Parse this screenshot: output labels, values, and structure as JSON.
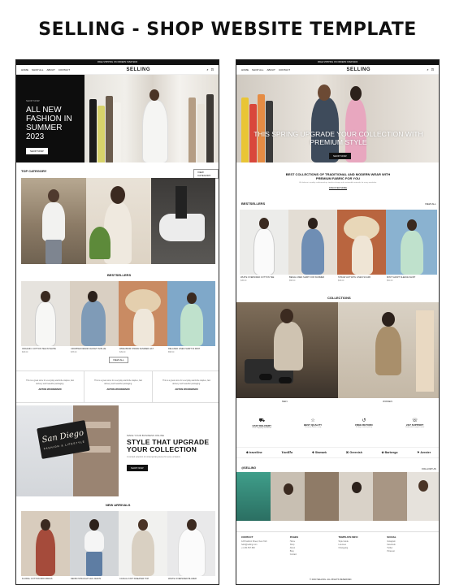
{
  "headline": "SELLING - SHOP WEBSITE TEMPLATE",
  "left": {
    "topbar": "FREE SHIPPING ON ORDERS OVER $100",
    "nav_links": [
      "HOME",
      "SHOP ALL",
      "ABOUT",
      "CONTACT"
    ],
    "logo": "SELLING",
    "hero": {
      "kicker": "SHOP NOW",
      "title_lines": [
        "ALL NEW",
        "FASHION IN",
        "SUMMER",
        "2023"
      ],
      "button": "SHOP NOW"
    },
    "top_category": {
      "label": "TOP CATEGORY",
      "button": "VIEW CATEGORY"
    },
    "bestsellers": {
      "label": "BESTSELLERS",
      "items": [
        {
          "name": "ORGANIC COTTON TEE IN WHITE",
          "price": "$45.00"
        },
        {
          "name": "CROPPED DENIM JACKET IN BLUE",
          "price": "$78.00"
        },
        {
          "name": "WIDE BRIM STRAW SUMMER HAT",
          "price": "$39.00"
        },
        {
          "name": "RELAXED LINEN SHIRT IN MINT",
          "price": "$58.00"
        }
      ],
      "button": "VIEW ALL"
    },
    "testimonials": [
      {
        "text": "This is a great store for everyday wardrobe staples, fast delivery and beautiful packaging.",
        "name": "ANTON WOODWARD"
      },
      {
        "text": "This is a great store for everyday wardrobe staples, fast delivery and beautiful packaging.",
        "name": "ANTON WOODWARD"
      },
      {
        "text": "This is a great store for everyday wardrobe staples, fast delivery and beautiful packaging.",
        "name": "ANTON WOODWARD"
      }
    ],
    "style": {
      "kicker": "MAKE YOUR BUSINESS ONLINE",
      "title_lines": [
        "STYLE THAT UPGRADE",
        "YOUR COLLECTION"
      ],
      "desc": "A curated selection of contemporary pieces for every occasion.",
      "button": "SHOP NOW",
      "sign_title": "San Diego",
      "sign_sub": "FASHION & LIFESTYLE"
    },
    "new_arrivals": {
      "label": "NEW ARRIVALS",
      "items": [
        {
          "name": "FLORAL COTTON MIDI DRESS",
          "price": "$64.00"
        },
        {
          "name": "DENIM STRAIGHT LEG JEANS",
          "price": "$72.00"
        },
        {
          "name": "CASUAL KNIT SWEATER TOP",
          "price": "$49.00"
        },
        {
          "name": "WHITE OVERSIZED BLAZER",
          "price": "$95.00"
        }
      ]
    }
  },
  "right": {
    "topbar": "FREE SHIPPING ON ORDERS OVER $100",
    "nav_links": [
      "HOME",
      "SHOP ALL",
      "ABOUT",
      "CONTACT"
    ],
    "logo": "SELLING",
    "hero": {
      "title_lines": [
        "THIS SPRING UPGRADE YOUR COLLECTION WITH",
        "PREMIUM STYLE"
      ],
      "button": "SHOP NOW"
    },
    "intro": {
      "title_lines": [
        "BEST COLLECTIONS OF TRADITIONAL AND MODERN WEAR WITH",
        "PREMIUM FABRIC FOR YOU"
      ],
      "desc": "We believe in quality craftsmanship, timeless design and sustainable materials for every wardrobe.",
      "link": "DISCOVER MORE"
    },
    "bestsellers": {
      "label": "BESTSELLERS",
      "link": "VIEW ALL",
      "items": [
        {
          "name": "WHITE OVERSIZED COTTON TEE",
          "price": "$45.00"
        },
        {
          "name": "BEIGE LINEN SHIRT FOR SUMMER",
          "price": "$58.00"
        },
        {
          "name": "STRAW HAT WITH LINEN SCARF",
          "price": "$39.00"
        },
        {
          "name": "MINT SHORT SLEEVE SHIRT",
          "price": "$52.00"
        }
      ]
    },
    "collections": {
      "label": "COLLECTIONS",
      "men": "MEN",
      "women": "WOMEN"
    },
    "features": [
      {
        "icon": "truck-icon",
        "glyph": "⛟",
        "title": "FAST DELIVERY",
        "desc": "Free shipping worldwide"
      },
      {
        "icon": "star-icon",
        "glyph": "☆",
        "title": "BEST QUALITY",
        "desc": "Premium fabrics only"
      },
      {
        "icon": "return-icon",
        "glyph": "↺",
        "title": "FREE RETURN",
        "desc": "30 days return policy"
      },
      {
        "icon": "support-icon",
        "glyph": "☏",
        "title": "24/7 SUPPORT",
        "desc": "Dedicated support team"
      }
    ],
    "brands": [
      "✱ travelline",
      "Vanilla",
      "✚ Stamark",
      "⌘ Greenish",
      "✿ Barbergo",
      "⚑ Aeroter"
    ],
    "instagram": {
      "handle": "@SELLING",
      "follow": "FOLLOW US"
    },
    "footer": {
      "cols": [
        {
          "title": "CONTACT",
          "lines": [
            "123 Fashion Street, New York",
            "hello@selling.com",
            "+1 234 567 890"
          ]
        },
        {
          "title": "PAGES",
          "lines": [
            "Home",
            "Shop",
            "About",
            "Blog",
            "Contact"
          ]
        },
        {
          "title": "TEMPLATE INFO",
          "lines": [
            "Style Guide",
            "Licenses",
            "Changelog"
          ]
        },
        {
          "title": "SOCIAL",
          "lines": [
            "Instagram",
            "Facebook",
            "Twitter",
            "Pinterest"
          ]
        }
      ],
      "copyright": "© 2023 SELLING. ALL RIGHTS RESERVED."
    }
  }
}
